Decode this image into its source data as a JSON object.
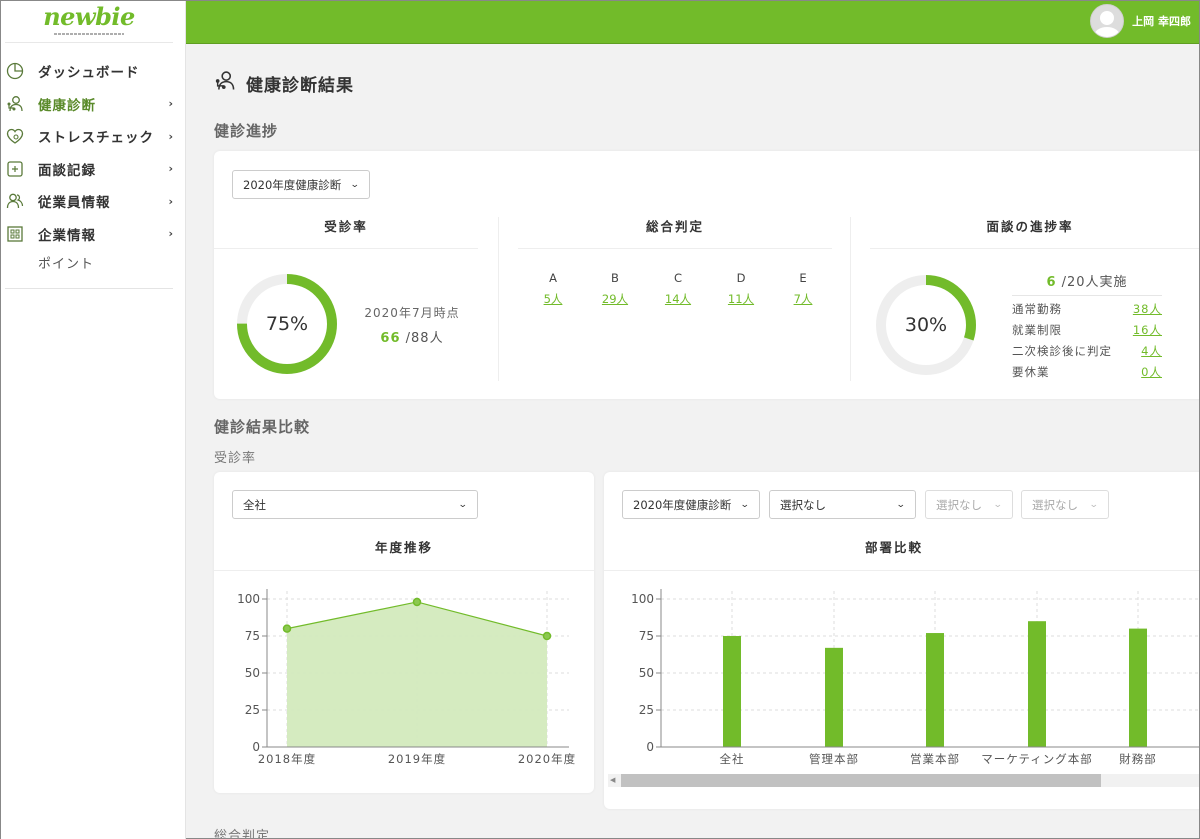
{
  "app": {
    "logo": "newbie",
    "user_name": "上岡 幸四郎"
  },
  "sidebar": {
    "items": [
      {
        "label": "ダッシュボード",
        "icon": "pie-chart-icon",
        "has_chevron": false
      },
      {
        "label": "健康診断",
        "icon": "health-checkup-icon",
        "has_chevron": true,
        "active": true
      },
      {
        "label": "ストレスチェック",
        "icon": "heart-icon",
        "has_chevron": true
      },
      {
        "label": "面談記録",
        "icon": "plus-box-icon",
        "has_chevron": true
      },
      {
        "label": "従業員情報",
        "icon": "users-icon",
        "has_chevron": true
      },
      {
        "label": "企業情報",
        "icon": "building-icon",
        "has_chevron": true
      }
    ],
    "sub_items": [
      {
        "label": "ポイント"
      }
    ],
    "chevron": "›"
  },
  "page": {
    "title": "健康診断結果",
    "title_icon": "health-checkup-icon"
  },
  "progress": {
    "heading": "健診進捗",
    "select_value": "2020年度健康診断",
    "exam_rate": {
      "title": "受診率",
      "percent": 75,
      "percent_label": "75%",
      "as_of": "2020年7月時点",
      "done": "66",
      "total": "/88人"
    },
    "overall": {
      "title": "総合判定",
      "grades": [
        {
          "grade": "A",
          "count": "5人"
        },
        {
          "grade": "B",
          "count": "29人"
        },
        {
          "grade": "C",
          "count": "14人"
        },
        {
          "grade": "D",
          "count": "11人"
        },
        {
          "grade": "E",
          "count": "7人"
        }
      ]
    },
    "interview": {
      "title": "面談の進捗率",
      "percent": 30,
      "percent_label": "30%",
      "done": "6",
      "total": "/20人実施",
      "rows": [
        {
          "label": "通常勤務",
          "count": "38人"
        },
        {
          "label": "就業制限",
          "count": "16人"
        },
        {
          "label": "二次検診後に判定",
          "count": "4人"
        },
        {
          "label": "要休業",
          "count": "0人"
        }
      ]
    }
  },
  "comparison": {
    "heading": "健診結果比較",
    "subheading": "受診率",
    "left": {
      "select_value": "全社",
      "title": "年度推移"
    },
    "right": {
      "selects": [
        {
          "value": "2020年度健康診断",
          "disabled": false
        },
        {
          "value": "選択なし",
          "disabled": false
        },
        {
          "value": "選択なし",
          "disabled": true
        },
        {
          "value": "選択なし",
          "disabled": true
        }
      ],
      "title": "部署比較"
    }
  },
  "next_section": {
    "heading": "総合判定"
  },
  "colors": {
    "accent": "#72bb2a",
    "area_fill": "#d3eabd",
    "track": "#eeeeee"
  },
  "chart_data": [
    {
      "type": "area",
      "title": "年度推移",
      "categories": [
        "2018年度",
        "2019年度",
        "2020年度"
      ],
      "values": [
        80,
        98,
        75
      ],
      "ylim": [
        0,
        100
      ],
      "yticks": [
        0,
        25,
        50,
        75,
        100
      ],
      "grid": true,
      "xlabel": "",
      "ylabel": ""
    },
    {
      "type": "bar",
      "title": "部署比較",
      "categories": [
        "全社",
        "管理本部",
        "営業本部",
        "マーケティング本部",
        "財務部"
      ],
      "values": [
        75,
        67,
        77,
        85,
        80
      ],
      "ylim": [
        0,
        100
      ],
      "yticks": [
        0,
        25,
        50,
        75,
        100
      ],
      "grid": true,
      "xlabel": "",
      "ylabel": ""
    }
  ]
}
